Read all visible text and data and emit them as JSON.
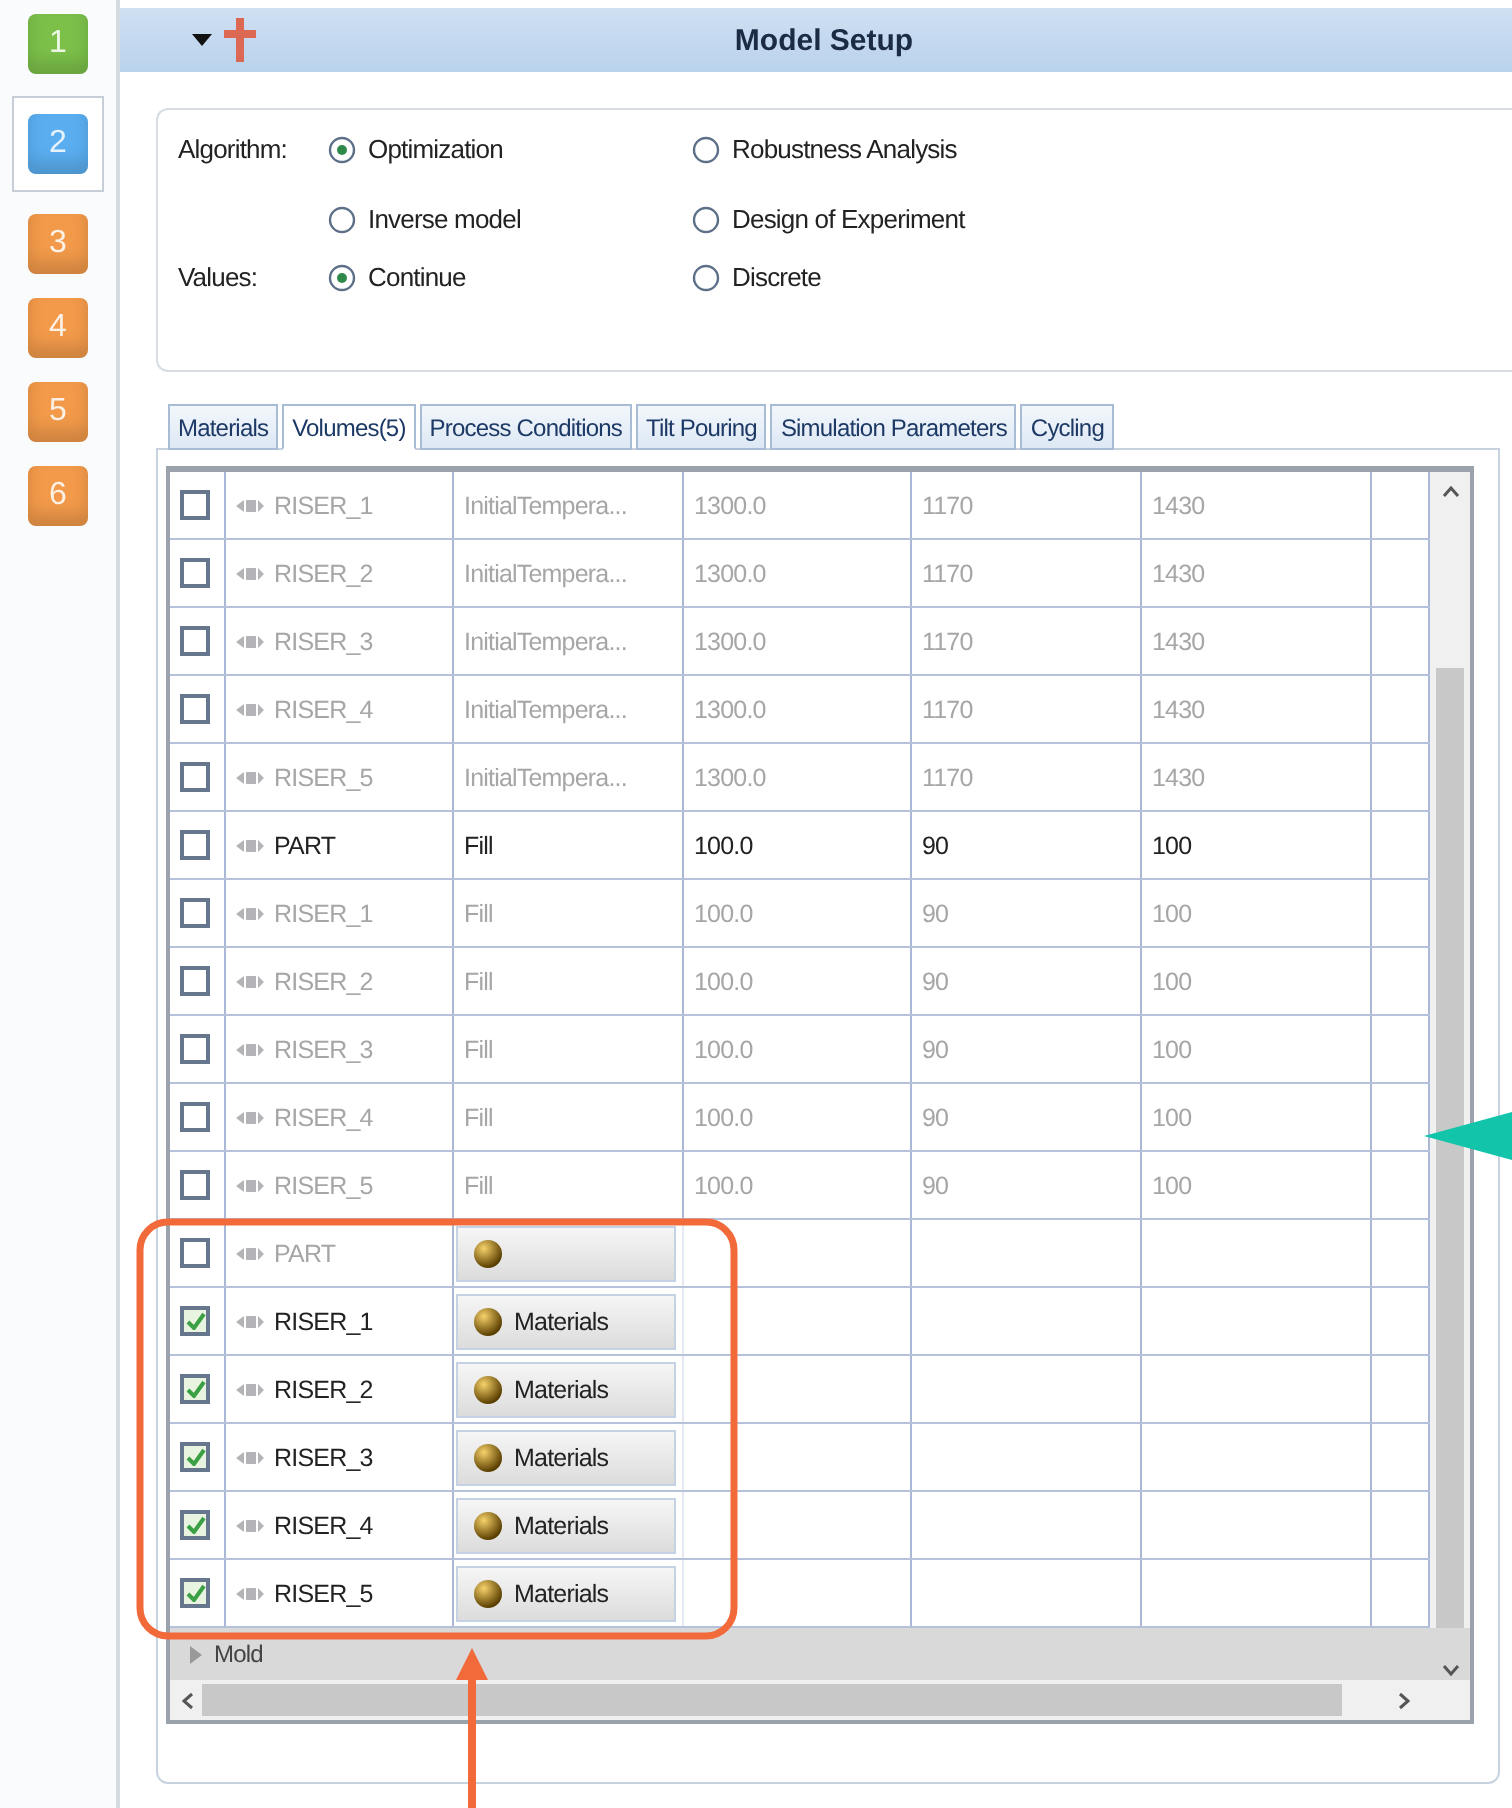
{
  "steps": [
    {
      "label": "1",
      "color": "#7cc04a",
      "selected": false
    },
    {
      "label": "2",
      "color": "#5aaef0",
      "selected": true
    },
    {
      "label": "3",
      "color": "#f29a4a",
      "selected": false
    },
    {
      "label": "4",
      "color": "#f29a4a",
      "selected": false
    },
    {
      "label": "5",
      "color": "#f29a4a",
      "selected": false
    },
    {
      "label": "6",
      "color": "#f29a4a",
      "selected": false
    }
  ],
  "header": {
    "title": "Model Setup"
  },
  "options": [
    {
      "label": "Algorithm:",
      "choices": [
        {
          "label": "Optimization",
          "selected": true
        },
        {
          "label": "Robustness Analysis",
          "selected": false
        },
        {
          "label": "Inverse model",
          "selected": false
        },
        {
          "label": "Design of Experiment",
          "selected": false
        }
      ]
    },
    {
      "label": "Values:",
      "choices": [
        {
          "label": "Continue",
          "selected": true
        },
        {
          "label": "Discrete",
          "selected": false
        }
      ]
    }
  ],
  "tabs": [
    {
      "label": "Materials",
      "selected": false
    },
    {
      "label": "Volumes(5)",
      "selected": true
    },
    {
      "label": "Process Conditions",
      "selected": false
    },
    {
      "label": "Tilt Pouring",
      "selected": false
    },
    {
      "label": "Simulation Parameters",
      "selected": false
    },
    {
      "label": "Cycling",
      "selected": false
    }
  ],
  "rows": [
    {
      "kind": "value",
      "checked": false,
      "disabled": true,
      "name": "RISER_1",
      "cells": [
        "InitialTempera...",
        "1300.0",
        "1170",
        "1430"
      ]
    },
    {
      "kind": "value",
      "checked": false,
      "disabled": true,
      "name": "RISER_2",
      "cells": [
        "InitialTempera...",
        "1300.0",
        "1170",
        "1430"
      ]
    },
    {
      "kind": "value",
      "checked": false,
      "disabled": true,
      "name": "RISER_3",
      "cells": [
        "InitialTempera...",
        "1300.0",
        "1170",
        "1430"
      ]
    },
    {
      "kind": "value",
      "checked": false,
      "disabled": true,
      "name": "RISER_4",
      "cells": [
        "InitialTempera...",
        "1300.0",
        "1170",
        "1430"
      ]
    },
    {
      "kind": "value",
      "checked": false,
      "disabled": true,
      "name": "RISER_5",
      "cells": [
        "InitialTempera...",
        "1300.0",
        "1170",
        "1430"
      ]
    },
    {
      "kind": "value",
      "checked": false,
      "disabled": false,
      "name": "PART",
      "cells": [
        "Fill",
        "100.0",
        "90",
        "100"
      ]
    },
    {
      "kind": "value",
      "checked": false,
      "disabled": true,
      "name": "RISER_1",
      "cells": [
        "Fill",
        "100.0",
        "90",
        "100"
      ]
    },
    {
      "kind": "value",
      "checked": false,
      "disabled": true,
      "name": "RISER_2",
      "cells": [
        "Fill",
        "100.0",
        "90",
        "100"
      ]
    },
    {
      "kind": "value",
      "checked": false,
      "disabled": true,
      "name": "RISER_3",
      "cells": [
        "Fill",
        "100.0",
        "90",
        "100"
      ]
    },
    {
      "kind": "value",
      "checked": false,
      "disabled": true,
      "name": "RISER_4",
      "cells": [
        "Fill",
        "100.0",
        "90",
        "100"
      ]
    },
    {
      "kind": "value",
      "checked": false,
      "disabled": true,
      "name": "RISER_5",
      "cells": [
        "Fill",
        "100.0",
        "90",
        "100"
      ]
    },
    {
      "kind": "material",
      "checked": false,
      "disabled": true,
      "name": "PART"
    },
    {
      "kind": "material",
      "checked": true,
      "disabled": false,
      "name": "RISER_1",
      "button": "Materials"
    },
    {
      "kind": "material",
      "checked": true,
      "disabled": false,
      "name": "RISER_2",
      "button": "Materials"
    },
    {
      "kind": "material",
      "checked": true,
      "disabled": false,
      "name": "RISER_3",
      "button": "Materials"
    },
    {
      "kind": "material",
      "checked": true,
      "disabled": false,
      "name": "RISER_4",
      "button": "Materials"
    },
    {
      "kind": "material",
      "checked": true,
      "disabled": false,
      "name": "RISER_5",
      "button": "Materials"
    }
  ],
  "group": {
    "label": "Mold",
    "expanded": false
  }
}
